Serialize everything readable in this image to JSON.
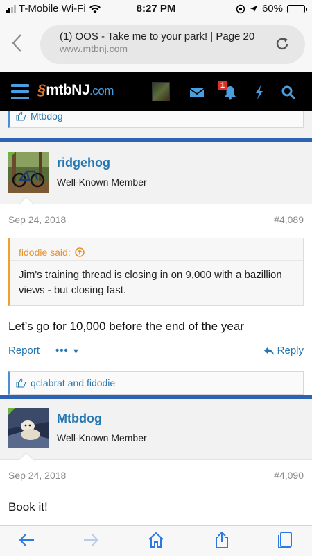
{
  "status_bar": {
    "carrier": "T-Mobile Wi-Fi",
    "time": "8:27 PM",
    "battery": "60%"
  },
  "browser": {
    "page_title": "(1) OOS - Take me to your park! | Page 20",
    "url": "www.mtbnj.com"
  },
  "site_header": {
    "logo_mark": "§",
    "logo_text": "mtbNJ",
    "logo_suffix": ".com",
    "alert_count": "1"
  },
  "top_reactions": "Mtbdog",
  "posts": [
    {
      "username": "ridgehog",
      "user_title": "Well-Known Member",
      "date": "Sep 24, 2018",
      "post_number": "#4,089",
      "quote_author": "fidodie said:",
      "quote_text": "Jim's training thread is closing in on 9,000 with a bazillion views - but closing fast.",
      "message": "Let’s go for 10,000 before the end of the year",
      "report_label": "Report",
      "more_label": "•••",
      "reply_label": "Reply",
      "reactions": "qclabrat and fidodie"
    },
    {
      "username": "Mtbdog",
      "user_title": "Well-Known Member",
      "date": "Sep 24, 2018",
      "post_number": "#4,090",
      "message": "Book it!"
    }
  ],
  "colors": {
    "link": "#2577b1",
    "accent_bar": "#2e62b3",
    "quote_accent": "#f0a030",
    "header_bg": "#000000",
    "header_icon": "#4a9fe0"
  }
}
